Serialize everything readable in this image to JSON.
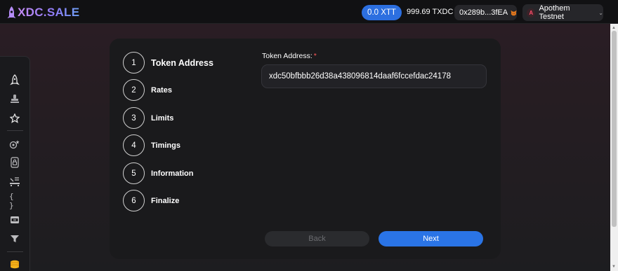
{
  "header": {
    "logo_text": "XDC.SALE",
    "balance_pill": "0.0 XTT",
    "native_balance": "999.69 TXDC",
    "wallet_address": "0x289b...3fEA",
    "network_letter": "A",
    "network_name": "Apothem Testnet",
    "accent_color": "#2c6fe0"
  },
  "sidebar": {
    "icons": [
      "rocket-icon",
      "stamp-icon",
      "star-icon",
      "coins-gear-icon",
      "lock-icon",
      "airdrop-icon",
      "code-braces-icon",
      "inbox-icon",
      "filter-icon",
      "coin-stack-icon"
    ]
  },
  "wizard": {
    "steps": [
      {
        "number": "1",
        "label": "Token Address"
      },
      {
        "number": "2",
        "label": "Rates"
      },
      {
        "number": "3",
        "label": "Limits"
      },
      {
        "number": "4",
        "label": "Timings"
      },
      {
        "number": "5",
        "label": "Information"
      },
      {
        "number": "6",
        "label": "Finalize"
      }
    ],
    "active_step": 1,
    "token_field": {
      "label": "Token Address:",
      "required_mark": "*",
      "value": "xdc50bfbbb26d38a438096814daaf6fccefdac24178"
    },
    "back_label": "Back",
    "next_label": "Next"
  }
}
